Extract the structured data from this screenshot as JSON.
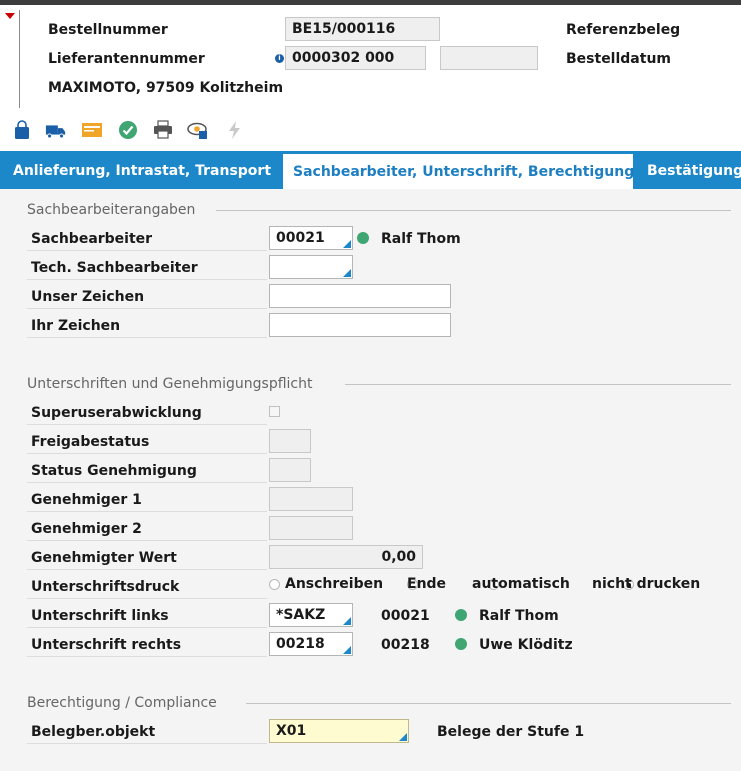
{
  "header": {
    "bestellnummer_label": "Bestellnummer",
    "bestellnummer_value": "BE15/000116",
    "referenzbeleg_label": "Referenzbeleg",
    "lieferantennummer_label": "Lieferantennummer",
    "lieferantennummer_value": "0000302 000",
    "bestelldatum_label": "Bestelldatum",
    "lieferant_address": "MAXIMOTO, 97509 Kolitzheim"
  },
  "toolbar": {
    "icons": [
      "shopping-bag-icon",
      "truck-icon",
      "envelope-icon",
      "checkmark-icon",
      "printer-icon",
      "preview-icon",
      "lightning-icon"
    ]
  },
  "tabs": [
    {
      "label": "Anlieferung, Intrastat, Transport"
    },
    {
      "label": "Sachbearbeiter, Unterschrift, Berechtigung"
    },
    {
      "label": "Bestätigungs"
    }
  ],
  "sachbearbeiter_group": {
    "title": "Sachbearbeiterangaben",
    "sachbearbeiter_label": "Sachbearbeiter",
    "sachbearbeiter_value": "00021",
    "sachbearbeiter_name": "Ralf Thom",
    "tech_label": "Tech. Sachbearbeiter",
    "tech_value": "",
    "unser_zeichen_label": "Unser Zeichen",
    "unser_zeichen_value": "",
    "ihr_zeichen_label": "Ihr Zeichen",
    "ihr_zeichen_value": ""
  },
  "unterschriften_group": {
    "title": "Unterschriften und Genehmigungspflicht",
    "superuser_label": "Superuserabwicklung",
    "superuser_checked": false,
    "freigabestatus_label": "Freigabestatus",
    "status_genehmigung_label": "Status Genehmigung",
    "genehmiger1_label": "Genehmiger 1",
    "genehmiger2_label": "Genehmiger 2",
    "genehmigter_wert_label": "Genehmigter Wert",
    "genehmigter_wert_value": "0,00",
    "unterschriftsdruck_label": "Unterschriftsdruck",
    "radio_options": [
      "Anschreiben",
      "Ende",
      "automatisch",
      "nicht drucken"
    ],
    "radio_selected": "nicht drucken",
    "links_label": "Unterschrift links",
    "links_value": "*SAKZ",
    "links_code": "00021",
    "links_name": "Ralf Thom",
    "rechts_label": "Unterschrift rechts",
    "rechts_value": "00218",
    "rechts_code": "00218",
    "rechts_name": "Uwe Klöditz"
  },
  "berechtigung_group": {
    "title": "Berechtigung / Compliance",
    "belegber_label": "Belegber.objekt",
    "belegber_value": "X01",
    "belegber_desc": "Belege der Stufe 1"
  },
  "colors": {
    "accent": "#1c88c9",
    "status_green": "#3ea573",
    "highlight_field": "#fffbd0"
  }
}
